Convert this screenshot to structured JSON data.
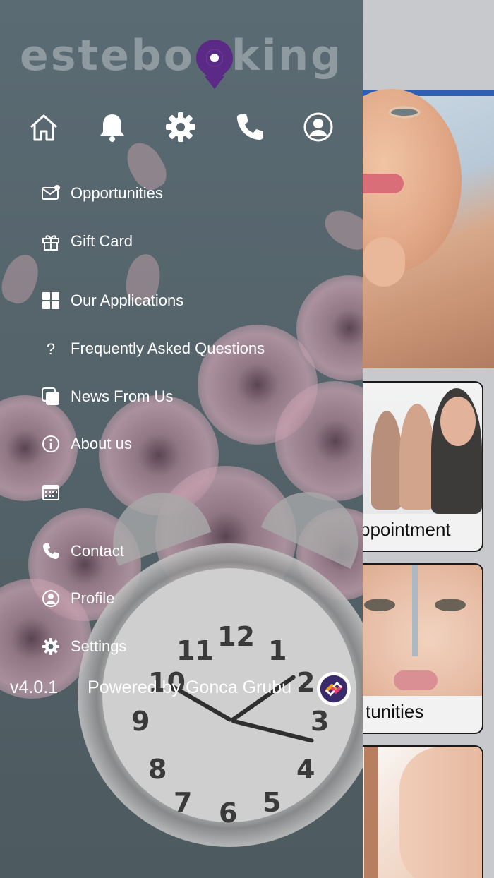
{
  "drawer": {
    "logo": {
      "text": "esteboking",
      "brand_color": "#5b2a86"
    },
    "top_icons": [
      {
        "name": "home-icon"
      },
      {
        "name": "bell-icon"
      },
      {
        "name": "gear-icon"
      },
      {
        "name": "phone-icon"
      },
      {
        "name": "user-circle-icon"
      }
    ],
    "menu": [
      {
        "label": "Opportunities",
        "icon": "mail-notification-icon"
      },
      {
        "label": "Gift Card",
        "icon": "gift-icon"
      },
      {
        "label": "Our Applications",
        "icon": "grid-icon"
      },
      {
        "label": "Frequently Asked Questions",
        "icon": "question-icon"
      },
      {
        "label": "News From Us",
        "icon": "pages-icon"
      },
      {
        "label": "About us",
        "icon": "info-icon"
      },
      {
        "label": "",
        "icon": "calendar-icon"
      },
      {
        "label": "Contact",
        "icon": "phone-icon"
      },
      {
        "label": "Profile",
        "icon": "user-circle-icon"
      },
      {
        "label": "Settings",
        "icon": "gear-icon"
      }
    ],
    "footer": {
      "version": "v4.0.1",
      "powered_by": "Powered by Gonca Grubu"
    }
  },
  "background_app": {
    "accent_bar_color": "#2f5fb5",
    "cards": [
      {
        "label": "ppointment"
      },
      {
        "label": "tunities"
      },
      {
        "label": ""
      }
    ]
  }
}
